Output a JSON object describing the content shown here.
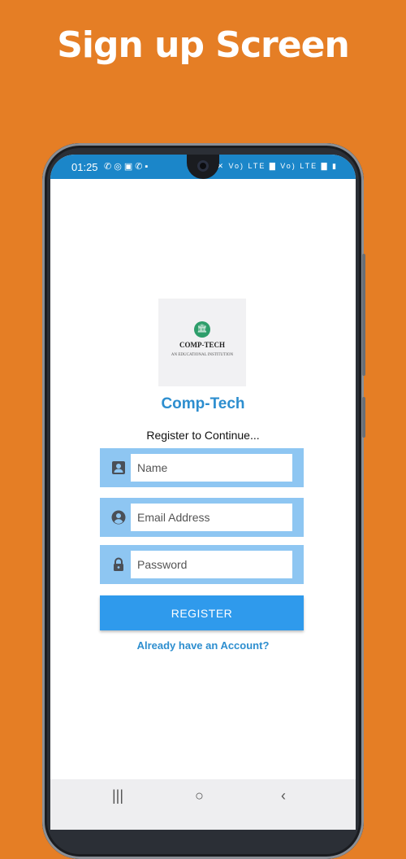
{
  "headline": "Sign up Screen",
  "statusbar": {
    "time": "01:25",
    "notification_icons": "✆◎▣✆▪",
    "system_icons": "✕ Vo) LTE ▇ Vo) LTE ▇ ▮",
    "color": "#1B86C9"
  },
  "logo": {
    "name": "COMP-TECH",
    "tagline": "AN EDUCATIONAL INSTITUTION",
    "mark_icon": "institution-icon"
  },
  "app_title": "Comp-Tech",
  "subtitle": "Register to Continue...",
  "form": {
    "name": {
      "placeholder": "Name",
      "value": "",
      "icon": "person-card-icon"
    },
    "email": {
      "placeholder": "Email Address",
      "value": "",
      "icon": "account-circle-icon"
    },
    "password": {
      "placeholder": "Password",
      "value": "",
      "icon": "lock-icon"
    }
  },
  "register_label": "REGISTER",
  "login_link": "Already have an Account?",
  "nav": {
    "recent": "|||",
    "home": "○",
    "back": "‹"
  },
  "colors": {
    "background": "#E57E25",
    "accent": "#2D8ECF",
    "field_bg": "#8EC6F2",
    "button": "#2F9AEC"
  }
}
